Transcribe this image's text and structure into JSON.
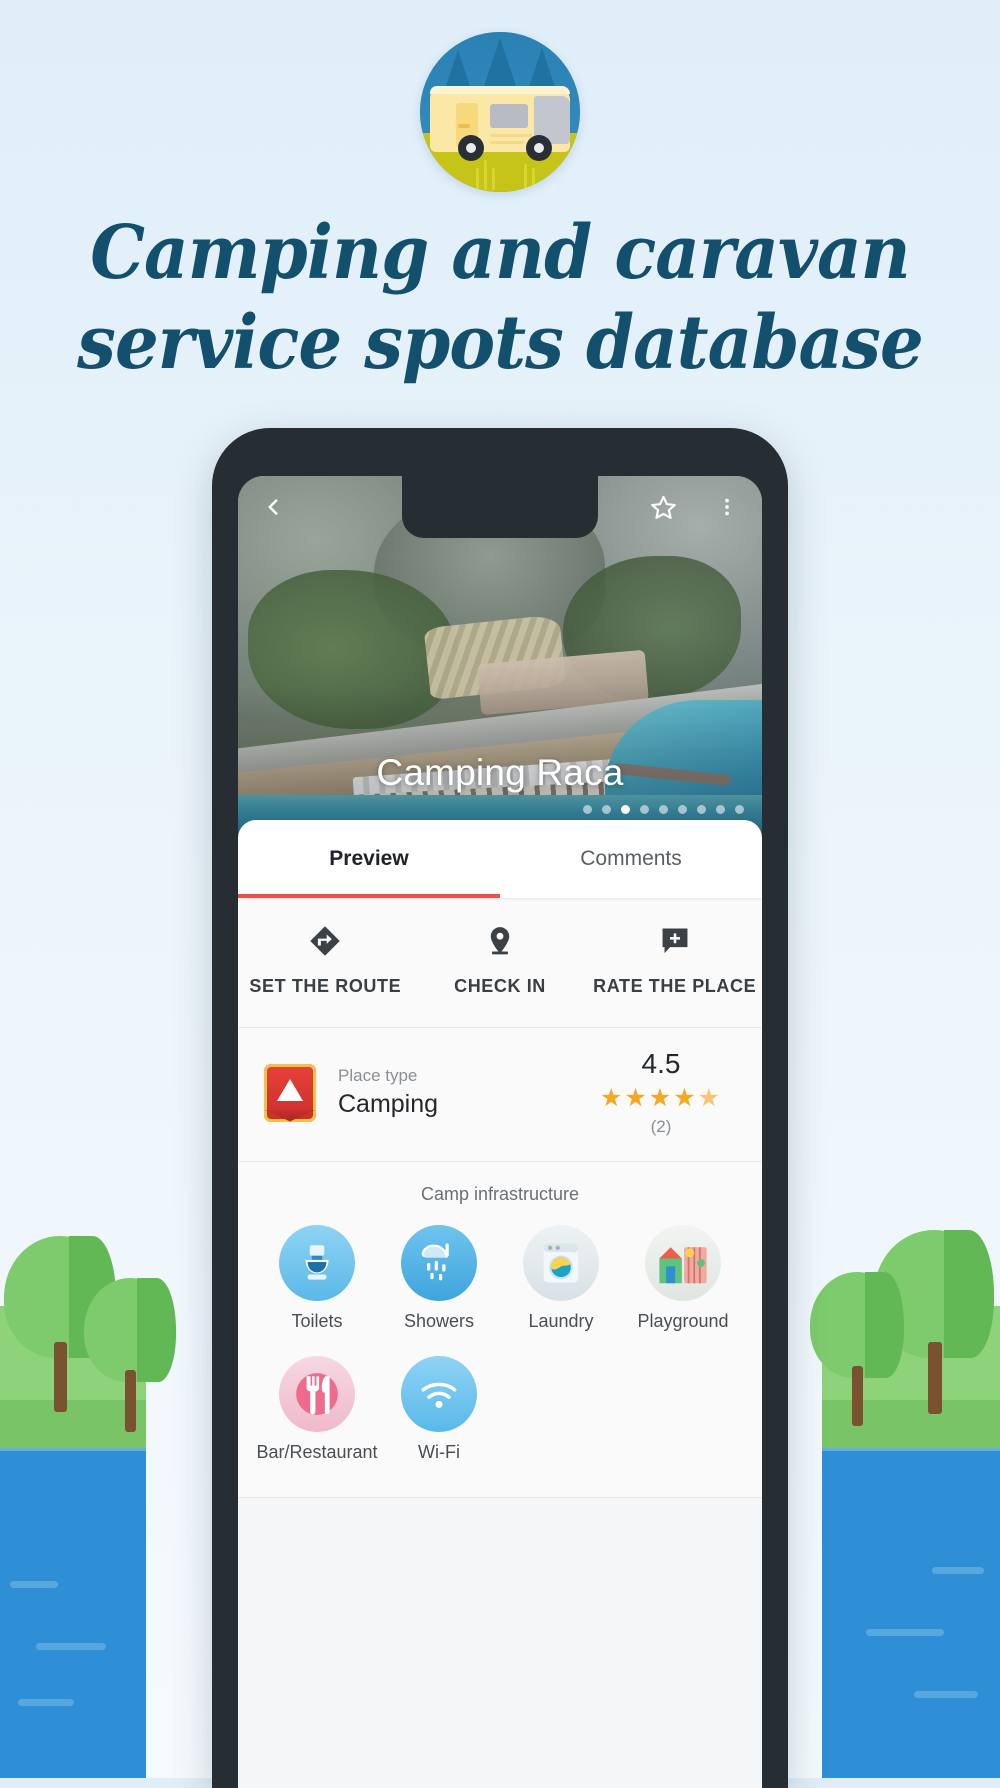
{
  "brand": {
    "logo_icon": "caravan-circle-logo",
    "accent_headline_color": "#13506e"
  },
  "headline": {
    "line1": "Camping and caravan",
    "line2": "service spots database"
  },
  "phone": {
    "hero": {
      "back_icon": "chevron-left-icon",
      "favorite_icon": "star-outline-icon",
      "overflow_icon": "more-vertical-icon",
      "place_title": "Camping Raca",
      "gallery_dots_total": 9,
      "gallery_dot_active_index": 2
    },
    "tabs": [
      {
        "label": "Preview",
        "active": true
      },
      {
        "label": "Comments",
        "active": false
      }
    ],
    "tab_indicator_color": "#e8524a",
    "actions": [
      {
        "label": "SET THE ROUTE",
        "icon": "directions-icon"
      },
      {
        "label": "CHECK IN",
        "icon": "location-pin-icon"
      },
      {
        "label": "RATE THE PLACE",
        "icon": "add-comment-icon"
      }
    ],
    "place": {
      "type_caption": "Place type",
      "type_value": "Camping",
      "type_icon": "camping-badge-icon",
      "rating_value": "4.5",
      "rating_stars": "★★★★",
      "rating_half_star": "★",
      "rating_count": "(2)",
      "star_color": "#f5a623"
    },
    "infrastructure": {
      "title": "Camp infrastructure",
      "items": [
        {
          "label": "Toilets",
          "icon": "toilet-icon"
        },
        {
          "label": "Showers",
          "icon": "shower-icon"
        },
        {
          "label": "Laundry",
          "icon": "washing-machine-icon"
        },
        {
          "label": "Playground",
          "icon": "playground-icon"
        },
        {
          "label": "Bar/Restaurant",
          "icon": "fork-knife-icon"
        },
        {
          "label": "Wi-Fi",
          "icon": "wifi-icon"
        }
      ]
    }
  }
}
